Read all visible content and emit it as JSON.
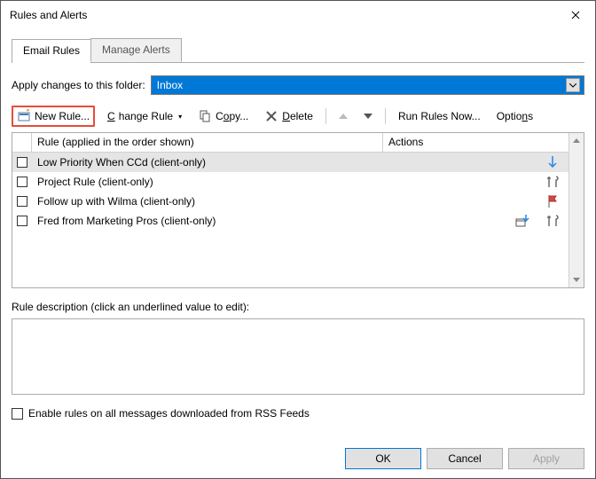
{
  "window": {
    "title": "Rules and Alerts"
  },
  "tabs": {
    "email": "Email Rules",
    "manage": "Manage Alerts"
  },
  "folder": {
    "label": "Apply changes to this folder:",
    "value": "Inbox"
  },
  "toolbar": {
    "new_rule": "New Rule...",
    "change_rule": "Change Rule",
    "copy": "Copy...",
    "delete": "Delete",
    "run_now": "Run Rules Now...",
    "options": "Options"
  },
  "grid": {
    "header_rule": "Rule (applied in the order shown)",
    "header_actions": "Actions",
    "rows": [
      {
        "name": "Low Priority When CCd  (client-only)"
      },
      {
        "name": "Project Rule  (client-only)"
      },
      {
        "name": "Follow up with Wilma  (client-only)"
      },
      {
        "name": "Fred from Marketing Pros  (client-only)"
      }
    ]
  },
  "description": {
    "label": "Rule description (click an underlined value to edit):"
  },
  "rss": {
    "label": "Enable rules on all messages downloaded from RSS Feeds"
  },
  "buttons": {
    "ok": "OK",
    "cancel": "Cancel",
    "apply": "Apply"
  }
}
